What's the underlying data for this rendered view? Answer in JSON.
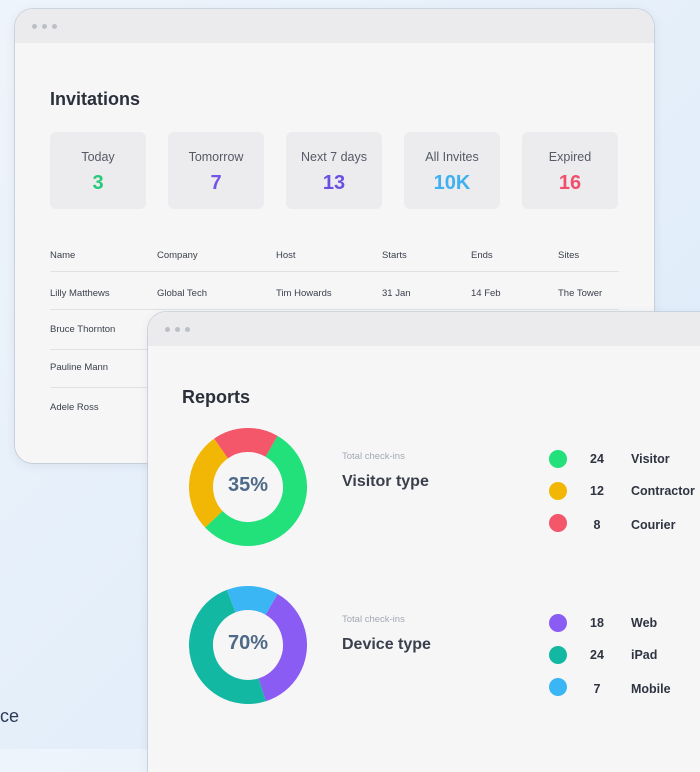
{
  "background": {
    "partial_text": "ce"
  },
  "invitations": {
    "title": "Invitations",
    "stats": [
      {
        "label": "Today",
        "value": "3",
        "color": "#27c97a"
      },
      {
        "label": "Tomorrow",
        "value": "7",
        "color": "#7355e6"
      },
      {
        "label": "Next 7 days",
        "value": "13",
        "color": "#6a4fe0"
      },
      {
        "label": "All Invites",
        "value": "10K",
        "color": "#3fb0f0"
      },
      {
        "label": "Expired",
        "value": "16",
        "color": "#f0506e"
      }
    ],
    "columns": [
      "Name",
      "Company",
      "Host",
      "Starts",
      "Ends",
      "Sites"
    ],
    "rows": [
      [
        "Lilly Matthews",
        "Global Tech",
        "Tim Howards",
        "31 Jan",
        "14 Feb",
        "The Tower"
      ],
      [
        "Bruce Thornton",
        "",
        "",
        "",
        "",
        ""
      ],
      [
        "Pauline Mann",
        "",
        "",
        "",
        "",
        ""
      ],
      [
        "Adele Ross",
        "",
        "",
        "",
        "",
        ""
      ]
    ]
  },
  "reports": {
    "title": "Reports",
    "sections": [
      {
        "subtitle": "Total check-ins",
        "title": "Visitor type",
        "percent": "35%",
        "items": [
          {
            "count": 24,
            "label": "Visitor",
            "color": "#22e07a"
          },
          {
            "count": 12,
            "label": "Contractor",
            "color": "#f2b705"
          },
          {
            "count": 8,
            "label": "Courier",
            "color": "#f4566a"
          }
        ]
      },
      {
        "subtitle": "Total check-ins",
        "title": "Device type",
        "percent": "70%",
        "items": [
          {
            "count": 18,
            "label": "Web",
            "color": "#8a5cf4"
          },
          {
            "count": 24,
            "label": "iPad",
            "color": "#12b8a2"
          },
          {
            "count": 7,
            "label": "Mobile",
            "color": "#3bb6f5"
          }
        ]
      }
    ]
  }
}
